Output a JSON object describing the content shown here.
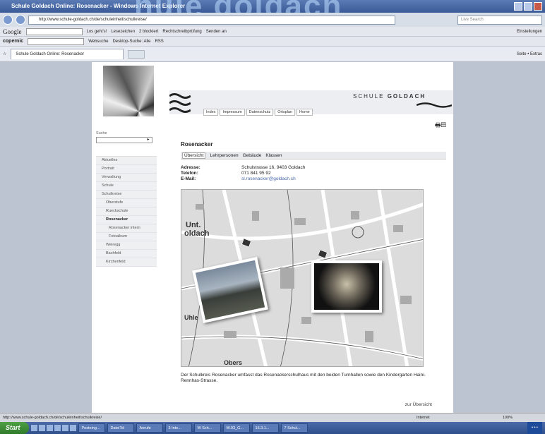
{
  "window": {
    "title": "Schule Goldach Online: Rosenacker - Windows Internet Explorer",
    "overlay_text": "hule goldach"
  },
  "address_bar": {
    "url": "http://www.schule-goldach.ch/de/schuleinheit/schulkreise/",
    "search_placeholder": "Live Search"
  },
  "toolbar1": {
    "google": "Google",
    "items": [
      "Los geht's!",
      "Lesezeichen",
      "2 blockiert",
      "Rechtschreibprüfung",
      "Senden an"
    ],
    "right": "Einstellungen"
  },
  "toolbar2": {
    "copernic": "copernic",
    "items": [
      "Websuche",
      "Desktop-Suche: Alle",
      "RSS"
    ]
  },
  "tab": {
    "label": "Schule Goldach Online: Rosenacker",
    "commands": "Seite • Extras"
  },
  "site": {
    "name_prefix": "SCHULE ",
    "name_bold": "GOLDACH",
    "topnav": [
      "Index",
      "Impressum",
      "Datenschutz",
      "Ortsplan",
      "Home"
    ],
    "search_label": "Suche",
    "menu": [
      {
        "label": "Aktuelles",
        "level": 0
      },
      {
        "label": "Portrait",
        "level": 0
      },
      {
        "label": "Verwaltung",
        "level": 0
      },
      {
        "label": "Schule",
        "level": 0
      },
      {
        "label": "Schulkreise",
        "level": 0
      },
      {
        "label": "Oberstufe",
        "level": 1
      },
      {
        "label": "Rueckschule",
        "level": 1
      },
      {
        "label": "Rosenacker",
        "level": 1,
        "active": true
      },
      {
        "label": "Rosenacker intern",
        "level": 2
      },
      {
        "label": "Fotoalbum",
        "level": 2
      },
      {
        "label": "Weiregg",
        "level": 1
      },
      {
        "label": "Bachfeld",
        "level": 1
      },
      {
        "label": "Kirchenfeld",
        "level": 1
      }
    ],
    "page_title": "Rosenacker",
    "subtabs": [
      "Übersicht",
      "Lehrpersonen",
      "Gebäude",
      "Klassen"
    ],
    "address_label": "Adresse:",
    "address_value": "Schulstrasse 16, 9403 Goldach",
    "phone_label": "Telefon:",
    "phone_value": "071 841 95 92",
    "email_label": "E-Mail:",
    "email_value": "sl.rosenacker@goldach.ch",
    "map_labels": [
      "Unt.",
      "oldach",
      "Uhle",
      "Obers"
    ],
    "description": "Der Schulkreis Rosenacker umfasst das Rosenackerschulhaus mit den beiden Turnhallen sowie den Kindergarten Haini-Rennhas-Strasse.",
    "back_link": "zur Übersicht"
  },
  "status": {
    "url": "http://www.schule-goldach.ch/de/schuleinheit/schulkreise/",
    "zone": "Internet",
    "zoom": "100%"
  },
  "taskbar": {
    "start": "Start",
    "tasks": [
      "Posteing...",
      "DateiTel",
      "Anrufe",
      "3 Inte...",
      "W Sch...",
      "W.03_G...",
      "15.3.1...",
      "7 Schul..."
    ]
  }
}
